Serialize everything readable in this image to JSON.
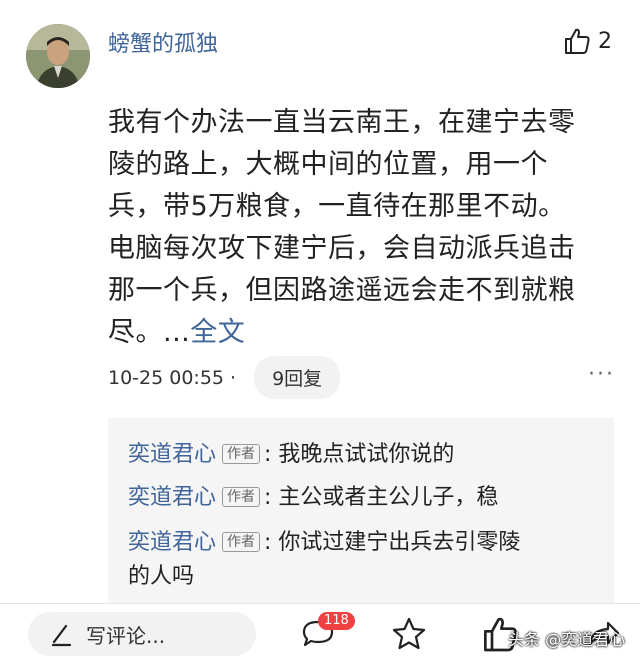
{
  "comment": {
    "username": "螃蟹的孤独",
    "like_count": "2",
    "content_lines": [
      "我有个办法一直当云南王，在建宁去零",
      "陵的路上，大概中间的位置，用一个",
      "兵，带5万粮食，一直待在那里不动。",
      "电脑每次攻下建宁后，会自动派兵追击",
      "那一个兵，但因路途遥远会走不到就粮",
      "尽。..."
    ],
    "more_link": "全文",
    "timestamp": "10-25 00:55 ·",
    "reply_count_label": "9回复",
    "more_menu": "···"
  },
  "replies": [
    {
      "author": "奕道君心",
      "tag": "作者",
      "text": ": 我晚点试试你说的"
    },
    {
      "author": "奕道君心",
      "tag": "作者",
      "text": ": 主公或者主公儿子，稳"
    },
    {
      "author": "奕道君心",
      "tag": "作者",
      "text": ": 你试过建宁出兵去引零陵",
      "text_line2": "的人吗"
    }
  ],
  "bottom_bar": {
    "write_placeholder": "写评论...",
    "comment_badge": "118"
  },
  "watermark": "头条 @奕道君心",
  "colors": {
    "link": "#406599",
    "badge": "#f04142",
    "reply_bg": "#f5f5f5"
  }
}
